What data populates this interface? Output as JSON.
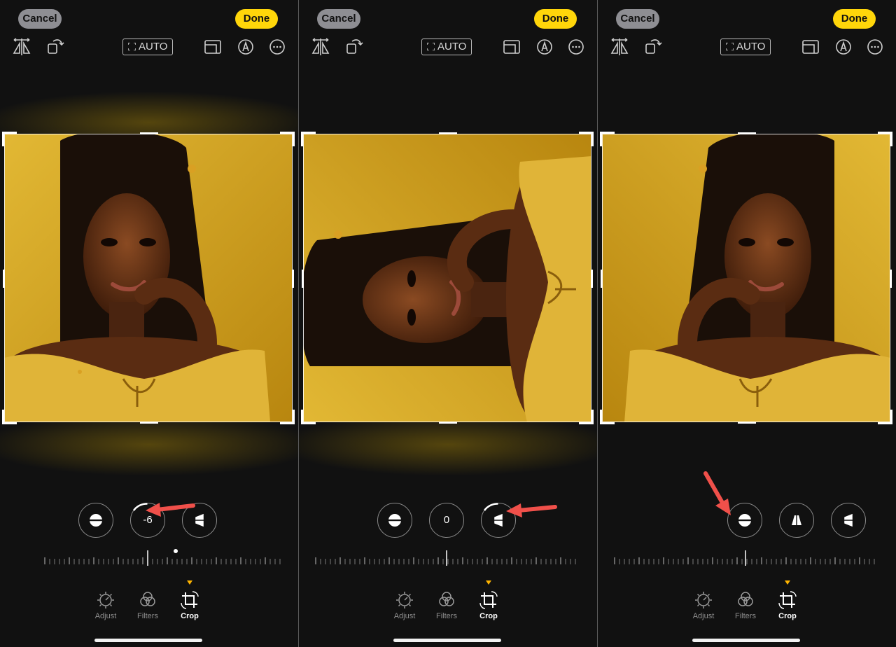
{
  "colors": {
    "accent": "#ffd60a",
    "selection_marker": "#ffb400",
    "annotation_arrow": "#f0504a",
    "panel_background": "#111111",
    "photo_backdrop": "#d6aa28"
  },
  "panels": [
    {
      "id": "panel-1",
      "cancel_label": "Cancel",
      "done_label": "Done",
      "auto_label": "AUTO",
      "photo_orientation": "upright",
      "knobs": [
        {
          "icon": "straighten-icon",
          "value": "",
          "active": false
        },
        {
          "icon": "vertical-perspective-icon",
          "value": "-6",
          "active": true
        },
        {
          "icon": "horizontal-perspective-icon",
          "value": "",
          "active": false
        }
      ],
      "slider_value": -6,
      "annotation": "arrow pointing at the active vertical-perspective control",
      "tabs": [
        {
          "label": "Adjust",
          "icon": "adjust-dial-icon",
          "active": false
        },
        {
          "label": "Filters",
          "icon": "filters-circles-icon",
          "active": false
        },
        {
          "label": "Crop",
          "icon": "crop-rotate-icon",
          "active": true
        }
      ]
    },
    {
      "id": "panel-2",
      "cancel_label": "Cancel",
      "done_label": "Done",
      "auto_label": "AUTO",
      "photo_orientation": "rotated 90 degrees",
      "knobs": [
        {
          "icon": "straighten-icon",
          "value": "",
          "active": false
        },
        {
          "icon": "",
          "value": "0",
          "active": false
        },
        {
          "icon": "horizontal-perspective-icon",
          "value": "",
          "active": true
        }
      ],
      "slider_value": 0,
      "annotation": "arrow pointing at the active horizontal-perspective control",
      "tabs": [
        {
          "label": "Adjust",
          "icon": "adjust-dial-icon",
          "active": false
        },
        {
          "label": "Filters",
          "icon": "filters-circles-icon",
          "active": false
        },
        {
          "label": "Crop",
          "icon": "crop-rotate-icon",
          "active": true
        }
      ]
    },
    {
      "id": "panel-3",
      "cancel_label": "Cancel",
      "done_label": "Done",
      "auto_label": "AUTO",
      "photo_orientation": "mirrored",
      "knobs": [
        {
          "icon": "straighten-icon",
          "value": "",
          "active": false
        },
        {
          "icon": "vertical-perspective-icon",
          "value": "",
          "active": false
        },
        {
          "icon": "horizontal-perspective-icon",
          "value": "",
          "active": false
        }
      ],
      "slider_value": 0,
      "annotation": "arrow pointing at the straighten control",
      "tabs": [
        {
          "label": "Adjust",
          "icon": "adjust-dial-icon",
          "active": false
        },
        {
          "label": "Filters",
          "icon": "filters-circles-icon",
          "active": false
        },
        {
          "label": "Crop",
          "icon": "crop-rotate-icon",
          "active": true
        }
      ]
    }
  ]
}
